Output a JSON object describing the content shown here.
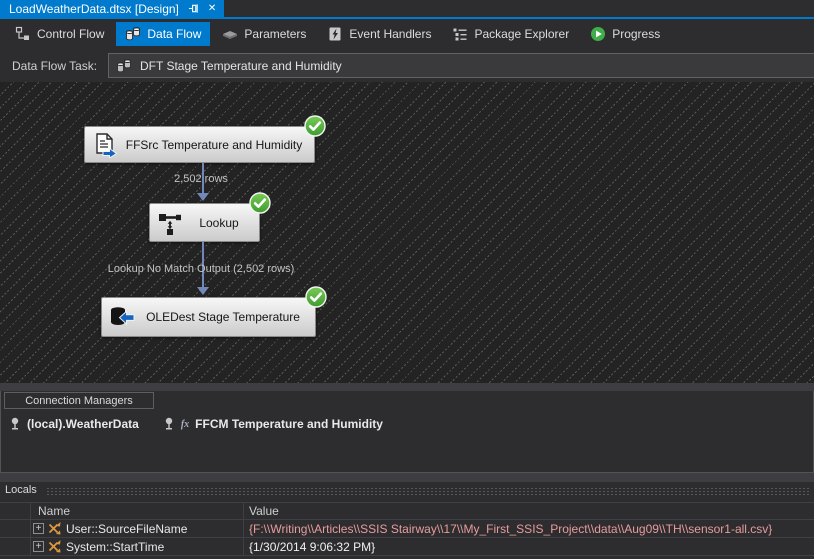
{
  "colors": {
    "accent": "#007acc",
    "success_badge": "#57b847",
    "flow_arrow": "#7288b8",
    "variable_icon": "#e09a3c",
    "changed_value_text": "#e79c9c"
  },
  "icons": {
    "close": "✕",
    "expander": "+",
    "expression": "fx"
  },
  "document_tab": {
    "title": "LoadWeatherData.dtsx [Design]"
  },
  "designer_tabs": [
    {
      "label": "Control Flow",
      "icon": "control-flow-icon",
      "selected": false
    },
    {
      "label": "Data Flow",
      "icon": "data-flow-icon",
      "selected": true
    },
    {
      "label": "Parameters",
      "icon": "parameters-icon",
      "selected": false
    },
    {
      "label": "Event Handlers",
      "icon": "event-handlers-icon",
      "selected": false
    },
    {
      "label": "Package Explorer",
      "icon": "package-explorer-icon",
      "selected": false
    },
    {
      "label": "Progress",
      "icon": "progress-icon",
      "selected": false
    }
  ],
  "task_selector": {
    "label": "Data Flow Task:",
    "value": "DFT Stage Temperature and Humidity"
  },
  "data_flow": {
    "nodes": [
      {
        "name": "FFSrc Temperature and Humidity",
        "type": "flat-file-source",
        "status": "success"
      },
      {
        "name": "Lookup",
        "type": "lookup",
        "status": "success"
      },
      {
        "name": "OLEDest Stage Temperature",
        "type": "oledb-destination",
        "status": "success"
      }
    ],
    "paths": [
      {
        "label": "2,502 rows"
      },
      {
        "label": "Lookup No Match Output (2,502 rows)"
      }
    ]
  },
  "connection_managers": {
    "title": "Connection Managers",
    "items": [
      {
        "name": "(local).WeatherData",
        "has_expression": false
      },
      {
        "name": "FFCM Temperature and Humidity",
        "has_expression": true
      }
    ]
  },
  "locals_panel": {
    "title": "Locals",
    "columns": [
      "Name",
      "Value"
    ],
    "rows": [
      {
        "name": "User::SourceFileName",
        "value": "{F:\\\\Writing\\\\Articles\\\\SSIS Stairway\\\\17\\\\My_First_SSIS_Project\\\\data\\\\Aug09\\\\TH\\\\sensor1-all.csv}",
        "changed": true
      },
      {
        "name": "System::StartTime",
        "value": "{1/30/2014 9:06:32 PM}",
        "changed": false
      }
    ]
  }
}
